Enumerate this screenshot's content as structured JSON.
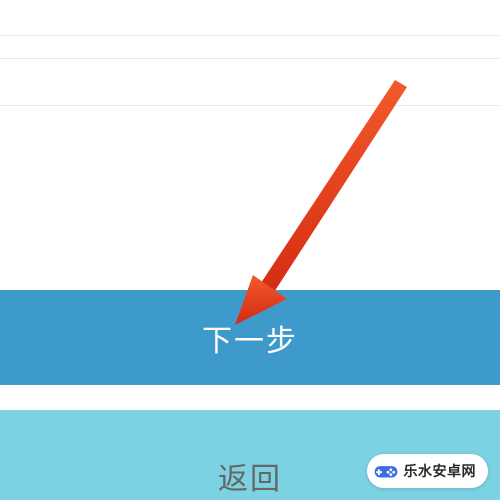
{
  "buttons": {
    "primary_label": "下一步",
    "secondary_label": "返回"
  },
  "watermark": {
    "text": "乐水安卓网"
  },
  "colors": {
    "primary_button_bg": "#3f9acc",
    "secondary_button_bg": "#7bd2e3",
    "arrow_stroke": "#e23b1a",
    "watermark_accent": "#3b6fe0"
  }
}
